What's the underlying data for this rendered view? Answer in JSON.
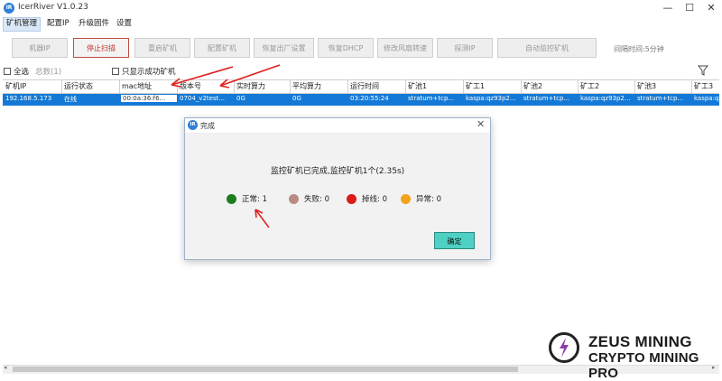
{
  "app": {
    "title": "IcerRiver V1.0.23",
    "icon_text": "IR"
  },
  "window_controls": {
    "minimize": "—",
    "maximize": "☐",
    "close": "✕"
  },
  "menu": [
    "矿机管理",
    "配置IP",
    "升级固件",
    "设置"
  ],
  "toolbar": {
    "buttons": [
      "机器IP",
      "停止扫描",
      "重启矿机",
      "配置矿机",
      "恢复出厂设置",
      "恢复DHCP",
      "修改风扇转速",
      "探测IP",
      "自动监控矿机"
    ],
    "interval_label": "间隔时间:5分钟"
  },
  "options": {
    "select_all": "全选",
    "total": "总数(1)",
    "only_success": "只显示成功矿机"
  },
  "table": {
    "headers": [
      "矿机IP",
      "运行状态",
      "mac地址",
      "版本号",
      "实时算力",
      "平均算力",
      "运行时间",
      "矿池1",
      "矿工1",
      "矿池2",
      "矿工2",
      "矿池3",
      "矿工3"
    ],
    "rows": [
      [
        "192.168.5.173",
        "在线",
        "00:0a:36:f6...",
        "0704_v2test...",
        "0G",
        "0G",
        "03:20:55:24",
        "stratum+tcp...",
        "kaspa:qz93p2...",
        "stratum+tcp...",
        "kaspa:qz93p2...",
        "stratum+tcp...",
        "kaspa:qz93p2..."
      ]
    ]
  },
  "dialog": {
    "icon_text": "IR",
    "title": "完成",
    "close": "✕",
    "message": "监控矿机已完成,监控矿机1个(2.35s)",
    "stats": [
      {
        "label": "正常: 1",
        "color": "#1e7d1e"
      },
      {
        "label": "失败: 0",
        "color": "#b98b86"
      },
      {
        "label": "掉线: 0",
        "color": "#dd1b1b"
      },
      {
        "label": "异常: 0",
        "color": "#f2a21b"
      }
    ],
    "ok_label": "确定"
  },
  "watermark": {
    "line1": "ZEUS MINING",
    "line2": "CRYPTO MINING PRO"
  },
  "colors": {
    "selection": "#1479d6",
    "accent_button": "#4ed1c4",
    "annotation_red": "#e02020"
  }
}
